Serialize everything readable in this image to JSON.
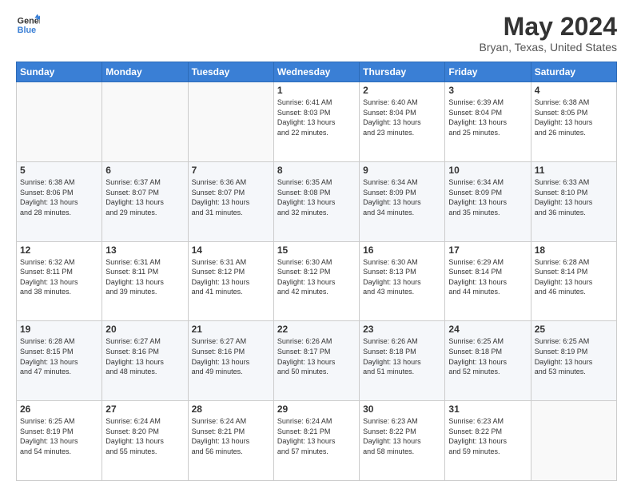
{
  "header": {
    "logo_line1": "General",
    "logo_line2": "Blue",
    "title": "May 2024",
    "subtitle": "Bryan, Texas, United States"
  },
  "days_of_week": [
    "Sunday",
    "Monday",
    "Tuesday",
    "Wednesday",
    "Thursday",
    "Friday",
    "Saturday"
  ],
  "weeks": [
    [
      {
        "day": "",
        "info": ""
      },
      {
        "day": "",
        "info": ""
      },
      {
        "day": "",
        "info": ""
      },
      {
        "day": "1",
        "info": "Sunrise: 6:41 AM\nSunset: 8:03 PM\nDaylight: 13 hours\nand 22 minutes."
      },
      {
        "day": "2",
        "info": "Sunrise: 6:40 AM\nSunset: 8:04 PM\nDaylight: 13 hours\nand 23 minutes."
      },
      {
        "day": "3",
        "info": "Sunrise: 6:39 AM\nSunset: 8:04 PM\nDaylight: 13 hours\nand 25 minutes."
      },
      {
        "day": "4",
        "info": "Sunrise: 6:38 AM\nSunset: 8:05 PM\nDaylight: 13 hours\nand 26 minutes."
      }
    ],
    [
      {
        "day": "5",
        "info": "Sunrise: 6:38 AM\nSunset: 8:06 PM\nDaylight: 13 hours\nand 28 minutes."
      },
      {
        "day": "6",
        "info": "Sunrise: 6:37 AM\nSunset: 8:07 PM\nDaylight: 13 hours\nand 29 minutes."
      },
      {
        "day": "7",
        "info": "Sunrise: 6:36 AM\nSunset: 8:07 PM\nDaylight: 13 hours\nand 31 minutes."
      },
      {
        "day": "8",
        "info": "Sunrise: 6:35 AM\nSunset: 8:08 PM\nDaylight: 13 hours\nand 32 minutes."
      },
      {
        "day": "9",
        "info": "Sunrise: 6:34 AM\nSunset: 8:09 PM\nDaylight: 13 hours\nand 34 minutes."
      },
      {
        "day": "10",
        "info": "Sunrise: 6:34 AM\nSunset: 8:09 PM\nDaylight: 13 hours\nand 35 minutes."
      },
      {
        "day": "11",
        "info": "Sunrise: 6:33 AM\nSunset: 8:10 PM\nDaylight: 13 hours\nand 36 minutes."
      }
    ],
    [
      {
        "day": "12",
        "info": "Sunrise: 6:32 AM\nSunset: 8:11 PM\nDaylight: 13 hours\nand 38 minutes."
      },
      {
        "day": "13",
        "info": "Sunrise: 6:31 AM\nSunset: 8:11 PM\nDaylight: 13 hours\nand 39 minutes."
      },
      {
        "day": "14",
        "info": "Sunrise: 6:31 AM\nSunset: 8:12 PM\nDaylight: 13 hours\nand 41 minutes."
      },
      {
        "day": "15",
        "info": "Sunrise: 6:30 AM\nSunset: 8:12 PM\nDaylight: 13 hours\nand 42 minutes."
      },
      {
        "day": "16",
        "info": "Sunrise: 6:30 AM\nSunset: 8:13 PM\nDaylight: 13 hours\nand 43 minutes."
      },
      {
        "day": "17",
        "info": "Sunrise: 6:29 AM\nSunset: 8:14 PM\nDaylight: 13 hours\nand 44 minutes."
      },
      {
        "day": "18",
        "info": "Sunrise: 6:28 AM\nSunset: 8:14 PM\nDaylight: 13 hours\nand 46 minutes."
      }
    ],
    [
      {
        "day": "19",
        "info": "Sunrise: 6:28 AM\nSunset: 8:15 PM\nDaylight: 13 hours\nand 47 minutes."
      },
      {
        "day": "20",
        "info": "Sunrise: 6:27 AM\nSunset: 8:16 PM\nDaylight: 13 hours\nand 48 minutes."
      },
      {
        "day": "21",
        "info": "Sunrise: 6:27 AM\nSunset: 8:16 PM\nDaylight: 13 hours\nand 49 minutes."
      },
      {
        "day": "22",
        "info": "Sunrise: 6:26 AM\nSunset: 8:17 PM\nDaylight: 13 hours\nand 50 minutes."
      },
      {
        "day": "23",
        "info": "Sunrise: 6:26 AM\nSunset: 8:18 PM\nDaylight: 13 hours\nand 51 minutes."
      },
      {
        "day": "24",
        "info": "Sunrise: 6:25 AM\nSunset: 8:18 PM\nDaylight: 13 hours\nand 52 minutes."
      },
      {
        "day": "25",
        "info": "Sunrise: 6:25 AM\nSunset: 8:19 PM\nDaylight: 13 hours\nand 53 minutes."
      }
    ],
    [
      {
        "day": "26",
        "info": "Sunrise: 6:25 AM\nSunset: 8:19 PM\nDaylight: 13 hours\nand 54 minutes."
      },
      {
        "day": "27",
        "info": "Sunrise: 6:24 AM\nSunset: 8:20 PM\nDaylight: 13 hours\nand 55 minutes."
      },
      {
        "day": "28",
        "info": "Sunrise: 6:24 AM\nSunset: 8:21 PM\nDaylight: 13 hours\nand 56 minutes."
      },
      {
        "day": "29",
        "info": "Sunrise: 6:24 AM\nSunset: 8:21 PM\nDaylight: 13 hours\nand 57 minutes."
      },
      {
        "day": "30",
        "info": "Sunrise: 6:23 AM\nSunset: 8:22 PM\nDaylight: 13 hours\nand 58 minutes."
      },
      {
        "day": "31",
        "info": "Sunrise: 6:23 AM\nSunset: 8:22 PM\nDaylight: 13 hours\nand 59 minutes."
      },
      {
        "day": "",
        "info": ""
      }
    ]
  ]
}
